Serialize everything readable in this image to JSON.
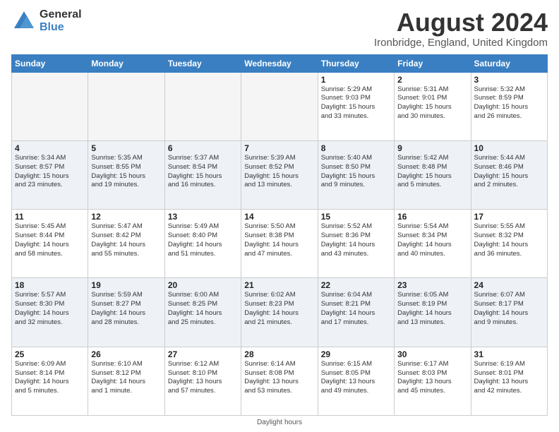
{
  "header": {
    "logo_general": "General",
    "logo_blue": "Blue",
    "month_title": "August 2024",
    "location": "Ironbridge, England, United Kingdom"
  },
  "footer": {
    "daylight_label": "Daylight hours"
  },
  "weekdays": [
    "Sunday",
    "Monday",
    "Tuesday",
    "Wednesday",
    "Thursday",
    "Friday",
    "Saturday"
  ],
  "weeks": [
    [
      {
        "day": "",
        "info": ""
      },
      {
        "day": "",
        "info": ""
      },
      {
        "day": "",
        "info": ""
      },
      {
        "day": "",
        "info": ""
      },
      {
        "day": "1",
        "info": "Sunrise: 5:29 AM\nSunset: 9:03 PM\nDaylight: 15 hours\nand 33 minutes."
      },
      {
        "day": "2",
        "info": "Sunrise: 5:31 AM\nSunset: 9:01 PM\nDaylight: 15 hours\nand 30 minutes."
      },
      {
        "day": "3",
        "info": "Sunrise: 5:32 AM\nSunset: 8:59 PM\nDaylight: 15 hours\nand 26 minutes."
      }
    ],
    [
      {
        "day": "4",
        "info": "Sunrise: 5:34 AM\nSunset: 8:57 PM\nDaylight: 15 hours\nand 23 minutes."
      },
      {
        "day": "5",
        "info": "Sunrise: 5:35 AM\nSunset: 8:55 PM\nDaylight: 15 hours\nand 19 minutes."
      },
      {
        "day": "6",
        "info": "Sunrise: 5:37 AM\nSunset: 8:54 PM\nDaylight: 15 hours\nand 16 minutes."
      },
      {
        "day": "7",
        "info": "Sunrise: 5:39 AM\nSunset: 8:52 PM\nDaylight: 15 hours\nand 13 minutes."
      },
      {
        "day": "8",
        "info": "Sunrise: 5:40 AM\nSunset: 8:50 PM\nDaylight: 15 hours\nand 9 minutes."
      },
      {
        "day": "9",
        "info": "Sunrise: 5:42 AM\nSunset: 8:48 PM\nDaylight: 15 hours\nand 5 minutes."
      },
      {
        "day": "10",
        "info": "Sunrise: 5:44 AM\nSunset: 8:46 PM\nDaylight: 15 hours\nand 2 minutes."
      }
    ],
    [
      {
        "day": "11",
        "info": "Sunrise: 5:45 AM\nSunset: 8:44 PM\nDaylight: 14 hours\nand 58 minutes."
      },
      {
        "day": "12",
        "info": "Sunrise: 5:47 AM\nSunset: 8:42 PM\nDaylight: 14 hours\nand 55 minutes."
      },
      {
        "day": "13",
        "info": "Sunrise: 5:49 AM\nSunset: 8:40 PM\nDaylight: 14 hours\nand 51 minutes."
      },
      {
        "day": "14",
        "info": "Sunrise: 5:50 AM\nSunset: 8:38 PM\nDaylight: 14 hours\nand 47 minutes."
      },
      {
        "day": "15",
        "info": "Sunrise: 5:52 AM\nSunset: 8:36 PM\nDaylight: 14 hours\nand 43 minutes."
      },
      {
        "day": "16",
        "info": "Sunrise: 5:54 AM\nSunset: 8:34 PM\nDaylight: 14 hours\nand 40 minutes."
      },
      {
        "day": "17",
        "info": "Sunrise: 5:55 AM\nSunset: 8:32 PM\nDaylight: 14 hours\nand 36 minutes."
      }
    ],
    [
      {
        "day": "18",
        "info": "Sunrise: 5:57 AM\nSunset: 8:30 PM\nDaylight: 14 hours\nand 32 minutes."
      },
      {
        "day": "19",
        "info": "Sunrise: 5:59 AM\nSunset: 8:27 PM\nDaylight: 14 hours\nand 28 minutes."
      },
      {
        "day": "20",
        "info": "Sunrise: 6:00 AM\nSunset: 8:25 PM\nDaylight: 14 hours\nand 25 minutes."
      },
      {
        "day": "21",
        "info": "Sunrise: 6:02 AM\nSunset: 8:23 PM\nDaylight: 14 hours\nand 21 minutes."
      },
      {
        "day": "22",
        "info": "Sunrise: 6:04 AM\nSunset: 8:21 PM\nDaylight: 14 hours\nand 17 minutes."
      },
      {
        "day": "23",
        "info": "Sunrise: 6:05 AM\nSunset: 8:19 PM\nDaylight: 14 hours\nand 13 minutes."
      },
      {
        "day": "24",
        "info": "Sunrise: 6:07 AM\nSunset: 8:17 PM\nDaylight: 14 hours\nand 9 minutes."
      }
    ],
    [
      {
        "day": "25",
        "info": "Sunrise: 6:09 AM\nSunset: 8:14 PM\nDaylight: 14 hours\nand 5 minutes."
      },
      {
        "day": "26",
        "info": "Sunrise: 6:10 AM\nSunset: 8:12 PM\nDaylight: 14 hours\nand 1 minute."
      },
      {
        "day": "27",
        "info": "Sunrise: 6:12 AM\nSunset: 8:10 PM\nDaylight: 13 hours\nand 57 minutes."
      },
      {
        "day": "28",
        "info": "Sunrise: 6:14 AM\nSunset: 8:08 PM\nDaylight: 13 hours\nand 53 minutes."
      },
      {
        "day": "29",
        "info": "Sunrise: 6:15 AM\nSunset: 8:05 PM\nDaylight: 13 hours\nand 49 minutes."
      },
      {
        "day": "30",
        "info": "Sunrise: 6:17 AM\nSunset: 8:03 PM\nDaylight: 13 hours\nand 45 minutes."
      },
      {
        "day": "31",
        "info": "Sunrise: 6:19 AM\nSunset: 8:01 PM\nDaylight: 13 hours\nand 42 minutes."
      }
    ]
  ]
}
